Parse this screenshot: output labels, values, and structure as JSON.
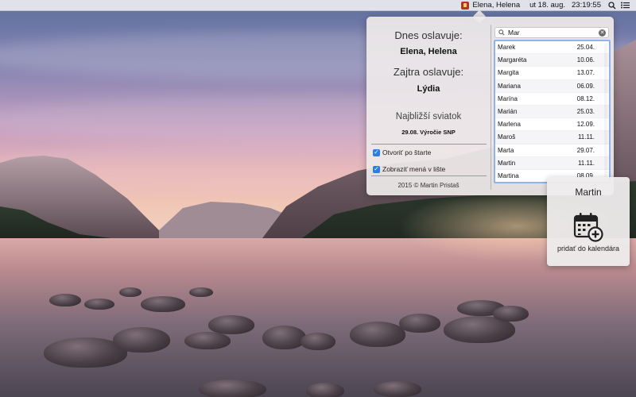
{
  "menubar": {
    "status_text": "Elena, Helena",
    "date": "ut 18. aug.",
    "time": "23:19:55",
    "icons": [
      "app-badge-icon",
      "search-icon",
      "list-icon"
    ]
  },
  "popover": {
    "today_title": "Dnes oslavuje:",
    "today_names": "Elena, Helena",
    "tomorrow_title": "Zajtra oslavuje:",
    "tomorrow_names": "Lýdia",
    "holiday_title": "Najbližší sviatok",
    "holiday_value": "29.08. Výročie SNP",
    "option_open": "Otvoriť po štarte",
    "option_show": "Zobraziť mená v lište",
    "copyright": "2015 © Martin Pristaš",
    "search": {
      "value": "Mar",
      "placeholder": ""
    },
    "names": [
      {
        "name": "Marek",
        "date": "25.04."
      },
      {
        "name": "Margaréta",
        "date": "10.06."
      },
      {
        "name": "Margita",
        "date": "13.07."
      },
      {
        "name": "Mariana",
        "date": "06.09."
      },
      {
        "name": "Marína",
        "date": "08.12."
      },
      {
        "name": "Marián",
        "date": "25.03."
      },
      {
        "name": "Marlena",
        "date": "12.09."
      },
      {
        "name": "Maroš",
        "date": "11.11."
      },
      {
        "name": "Marta",
        "date": "29.07."
      },
      {
        "name": "Martin",
        "date": "11.11."
      },
      {
        "name": "Martina",
        "date": "08.09."
      }
    ]
  },
  "card": {
    "name": "Martin",
    "action": "pridať do kalendára",
    "icon": "calendar-add-icon"
  },
  "colors": {
    "accent": "#2a7de1",
    "list_border": "#8fb4e8"
  }
}
